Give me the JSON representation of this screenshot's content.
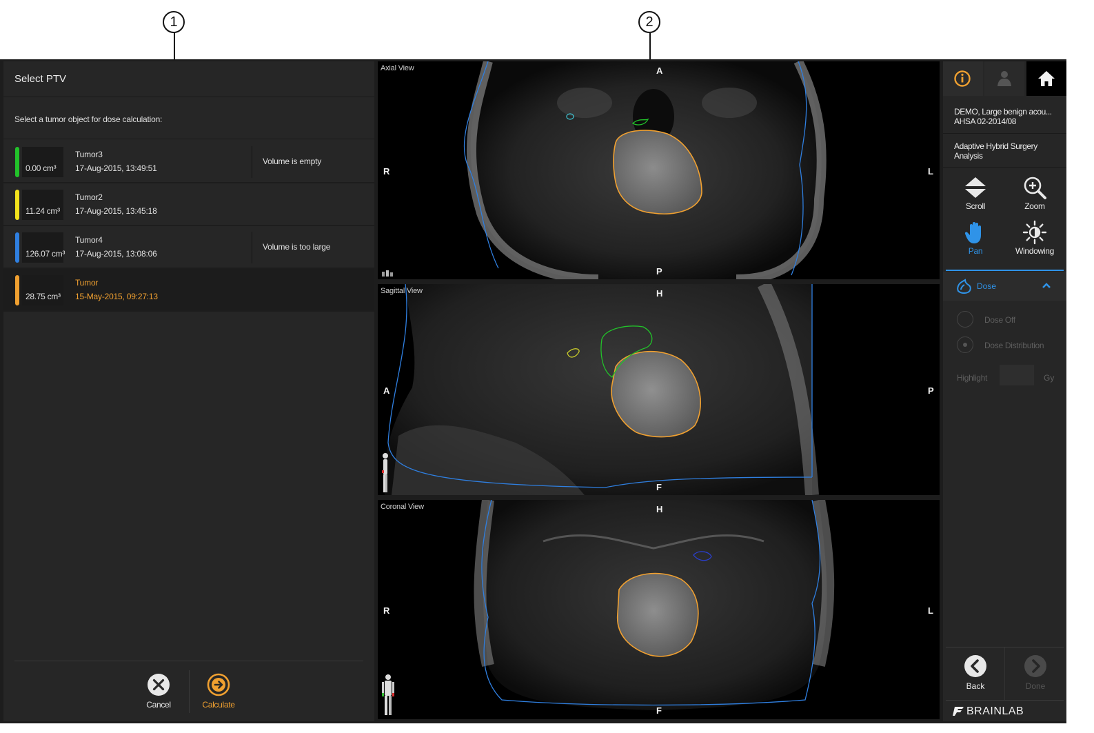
{
  "callouts": [
    "1",
    "2"
  ],
  "select_ptv": {
    "title": "Select PTV",
    "instruction": "Select a tumor object for dose calculation:",
    "tumors": [
      {
        "volume": "0.00 cm³",
        "name": "Tumor3",
        "date": "17-Aug-2015, 13:49:51",
        "status": "Volume is empty",
        "color": "#22c22a",
        "selected": false
      },
      {
        "volume": "11.24 cm³",
        "name": "Tumor2",
        "date": "17-Aug-2015, 13:45:18",
        "status": "",
        "color": "#f2e21c",
        "selected": false
      },
      {
        "volume": "126.07 cm³",
        "name": "Tumor4",
        "date": "17-Aug-2015, 13:08:06",
        "status": "Volume is too large",
        "color": "#2f7fe0",
        "selected": false
      },
      {
        "volume": "28.75 cm³",
        "name": "Tumor",
        "date": "15-May-2015, 09:27:13",
        "status": "",
        "color": "#f0a030",
        "selected": true
      }
    ],
    "cancel_label": "Cancel",
    "calculate_label": "Calculate"
  },
  "views": {
    "axial": {
      "label": "Axial View",
      "top": "A",
      "bottom": "P",
      "left": "R",
      "right": "L"
    },
    "sagittal": {
      "label": "Sagittal View",
      "top": "H",
      "bottom": "F",
      "left": "A",
      "right": "P"
    },
    "coronal": {
      "label": "Coronal View",
      "top": "H",
      "bottom": "F",
      "left": "R",
      "right": "L"
    }
  },
  "sidebar": {
    "patient_line1": "DEMO, Large benign acou...",
    "patient_line2": "AHSA 02-2014/08",
    "analysis_line1": "Adaptive Hybrid Surgery",
    "analysis_line2": "Analysis",
    "tools": {
      "scroll": "Scroll",
      "zoom": "Zoom",
      "pan": "Pan",
      "windowing": "Windowing"
    },
    "dose_label": "Dose",
    "dose_off": "Dose Off",
    "dose_distribution": "Dose Distribution",
    "highlight": "Highlight",
    "unit": "Gy",
    "back": "Back",
    "done": "Done",
    "brand": "BRAINLAB"
  },
  "colors": {
    "accent_orange": "#f0a030",
    "accent_blue": "#2f93e8"
  }
}
